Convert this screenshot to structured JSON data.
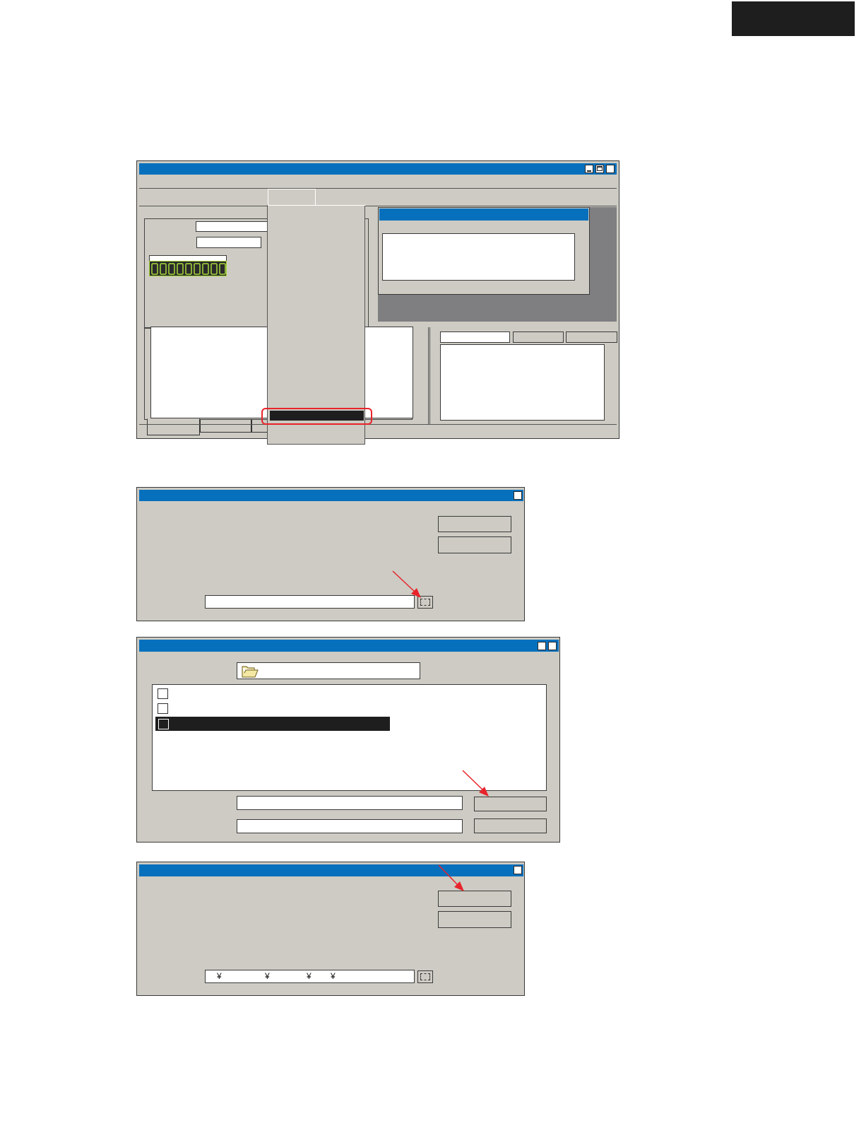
{
  "colors": {
    "titlebar": "#0670bd",
    "window_face": "#cdcbc3",
    "desktop_gray": "#7f7f82",
    "highlight": "#1e1e1e",
    "led_green": "#a8d93a",
    "annotation_red": "#e8232b"
  },
  "icons": {
    "minimize": "minimize-icon",
    "maximize": "maximize-icon",
    "close": "close-icon",
    "folder": "folder-icon",
    "browse": "browse-icon",
    "arrow": "red-arrow-annotation"
  },
  "main_window": {
    "led_segments": 9
  },
  "dialog3": {
    "path_value": [
      "¥",
      "¥",
      "¥",
      "¥"
    ]
  }
}
